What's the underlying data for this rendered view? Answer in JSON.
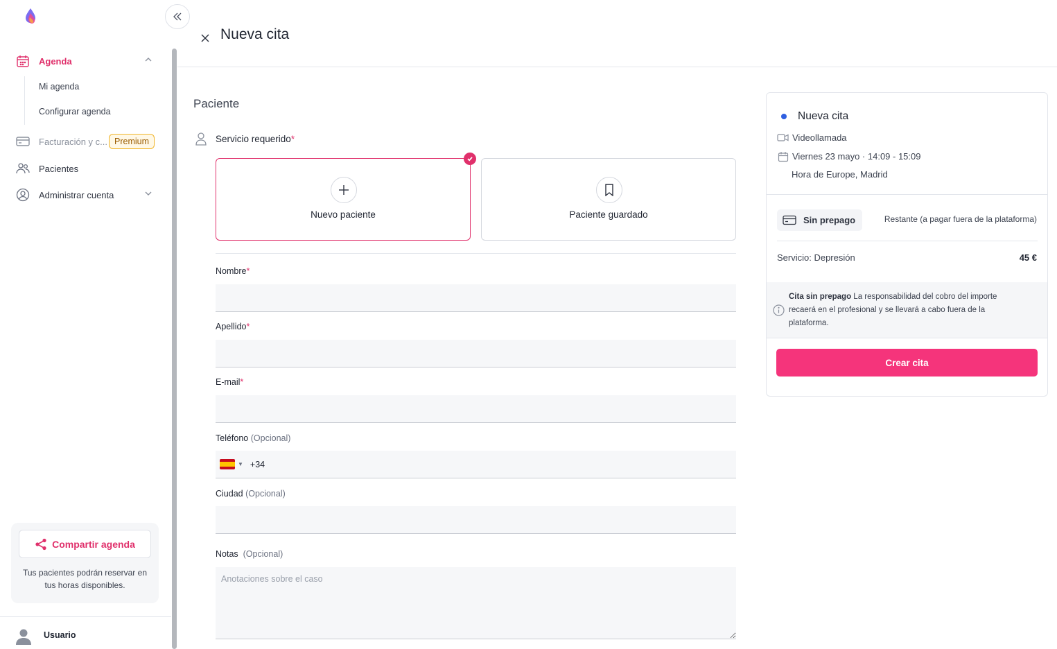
{
  "sidebar": {
    "items": [
      {
        "label": "Agenda"
      },
      {
        "label": "Mi agenda"
      },
      {
        "label": "Configurar agenda"
      },
      {
        "label": "Facturación y c..."
      },
      {
        "label": "Pacientes"
      },
      {
        "label": "Administrar cuenta"
      }
    ],
    "premium_badge": "Premium",
    "share_button": "Compartir agenda",
    "share_text": "Tus pacientes podrán reservar en tus horas disponibles.",
    "user_name": "Usuario"
  },
  "header": {
    "title": "Nueva cita"
  },
  "form": {
    "section_title": "Paciente",
    "service_label": "Servicio requerido",
    "required_mark": "*",
    "options": [
      {
        "label": "Nuevo paciente",
        "selected": true
      },
      {
        "label": "Paciente guardado",
        "selected": false
      }
    ],
    "fields": {
      "nombre": "Nombre",
      "apellido": "Apellido",
      "email": "E-mail",
      "telefono": "Teléfono",
      "ciudad": "Ciudad",
      "notas": "Notas"
    },
    "optional_tag": "(Opcional)",
    "phone_prefix": "+34",
    "notes_placeholder": "Anotaciones sobre el caso"
  },
  "summary": {
    "title": "Nueva cita",
    "modality": "Videollamada",
    "datetime": "Viernes 23 mayo · 14:09 - 15:09",
    "timezone": "Hora de Europe, Madrid",
    "payment_badge": "Sin prepago",
    "remaining": "Restante (a pagar fuera de la plataforma)",
    "service": "Servicio: Depresión",
    "price": "45 €",
    "notice_bold": "Cita sin prepago",
    "notice_text": " La responsabilidad del cobro del importe recaerá en el profesional y se llevará a cabo fuera de la plataforma.",
    "submit": "Crear cita"
  },
  "colors": {
    "accent": "#e0306b",
    "button": "#f5347b",
    "dot": "#2f5fe0",
    "premium_border": "#f0b429"
  }
}
